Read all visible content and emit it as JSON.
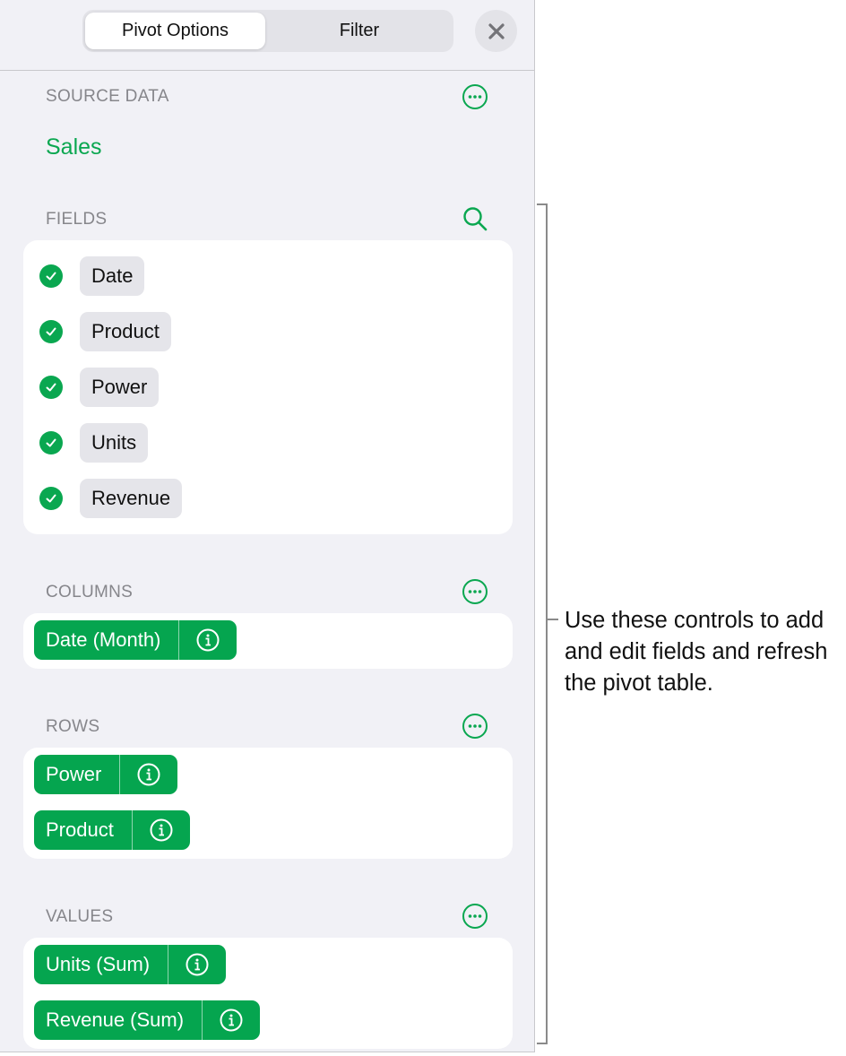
{
  "header": {
    "tabs": [
      {
        "label": "Pivot Options",
        "active": true
      },
      {
        "label": "Filter",
        "active": false
      }
    ],
    "close_icon": "close-icon"
  },
  "source_data": {
    "label": "SOURCE DATA",
    "value": "Sales",
    "more_icon": "ellipsis-circle-icon"
  },
  "fields": {
    "label": "FIELDS",
    "search_icon": "search-icon",
    "items": [
      {
        "label": "Date",
        "checked": true
      },
      {
        "label": "Product",
        "checked": true
      },
      {
        "label": "Power",
        "checked": true
      },
      {
        "label": "Units",
        "checked": true
      },
      {
        "label": "Revenue",
        "checked": true
      }
    ]
  },
  "columns": {
    "label": "COLUMNS",
    "items": [
      {
        "label": "Date (Month)"
      }
    ]
  },
  "rows": {
    "label": "ROWS",
    "items": [
      {
        "label": "Power"
      },
      {
        "label": "Product"
      }
    ]
  },
  "values": {
    "label": "VALUES",
    "items": [
      {
        "label": "Units (Sum)"
      },
      {
        "label": "Revenue (Sum)"
      }
    ]
  },
  "callout": {
    "text": "Use these controls to add and edit fields and refresh the pivot table."
  },
  "colors": {
    "accent": "#0aa750",
    "pill": "#05a54f",
    "panel_bg": "#f1f1f6",
    "section_label": "#86868b"
  }
}
